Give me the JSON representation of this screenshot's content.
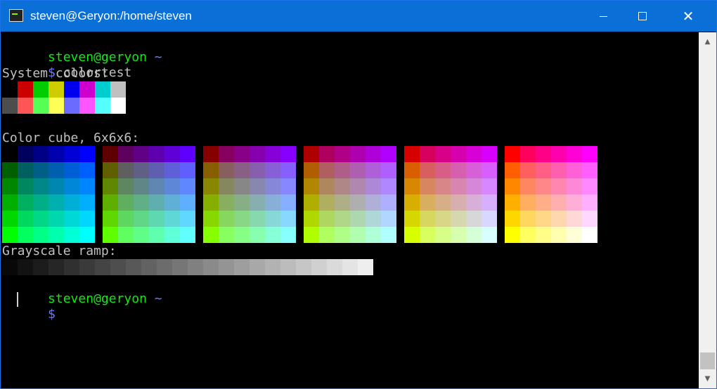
{
  "window": {
    "title": "steven@Geryon:/home/steven",
    "minimize_label": "minimize",
    "maximize_label": "maximize",
    "close_label": "close"
  },
  "terminal": {
    "prompt_user": "steven@geryon",
    "prompt_path": "~",
    "prompt_symbol": "$",
    "command": "colortest",
    "system_colors_label": "System colors:",
    "color_cube_label": "Color cube, 6x6x6:",
    "grayscale_label": "Grayscale ramp:",
    "system_colors_normal": [
      "#000000",
      "#cd0000",
      "#00cd00",
      "#cdcd00",
      "#0000ee",
      "#cd00cd",
      "#00cdcd",
      "#c0c0c0"
    ],
    "system_colors_bright": [
      "#4d4d4d",
      "#ff5555",
      "#55ff55",
      "#ffff55",
      "#6b6bff",
      "#ff55ff",
      "#55ffff",
      "#ffffff"
    ],
    "cube_levels": [
      0,
      95,
      135,
      175,
      215,
      255
    ],
    "grayscale_start": 8,
    "grayscale_step": 10,
    "grayscale_count": 24
  },
  "colors": {
    "prompt_green": "#13e813",
    "prompt_purple": "#6b7bff",
    "text": "#c0c0c0",
    "titlebar": "#0a6fd6"
  }
}
